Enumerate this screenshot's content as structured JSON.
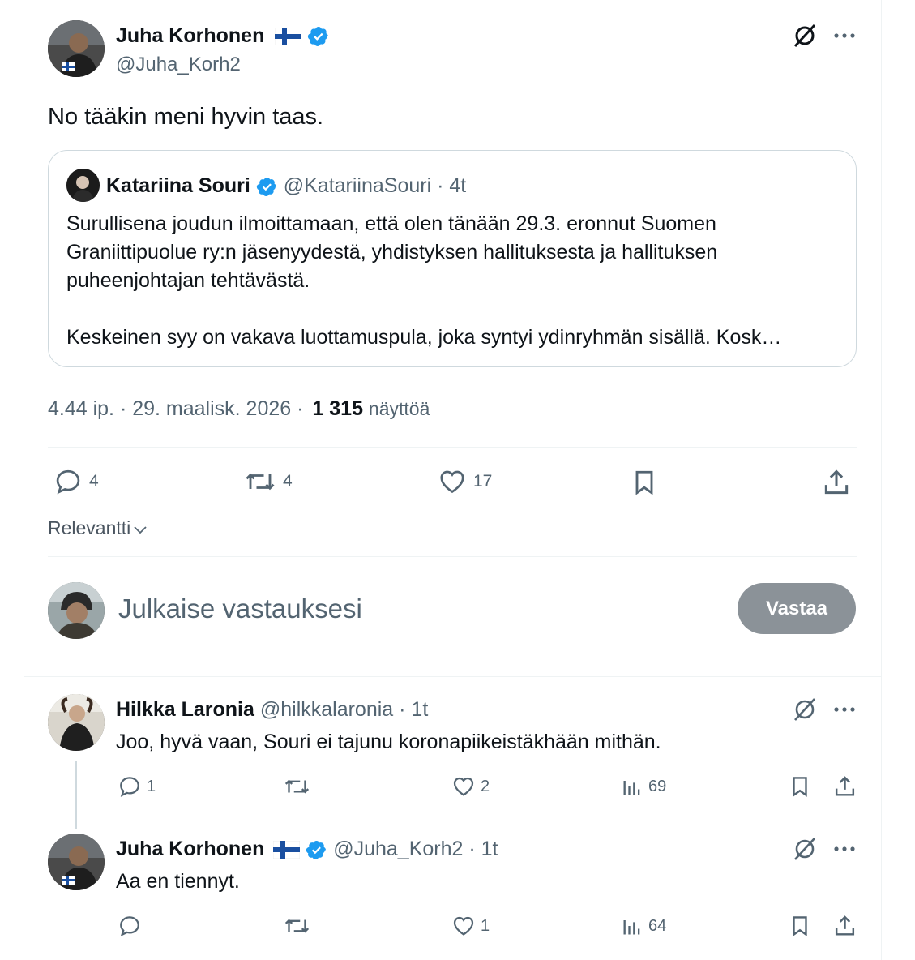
{
  "main_tweet": {
    "author_name": "Juha Korhonen",
    "author_handle": "@Juha_Korh2",
    "text": "No tääkin meni hyvin taas.",
    "timestamp": "4.44 ip. · 29. maalisk. 2026 ·",
    "views_count": "1 315",
    "views_label": "näyttöä",
    "replies": "4",
    "retweets": "4",
    "likes": "17"
  },
  "quoted_tweet": {
    "author_name": "Katariina Souri",
    "author_handle": "@KatariinaSouri",
    "time": "· 4t",
    "text_p1": "Surullisena joudun ilmoittamaan, että olen tänään 29.3. eronnut Suomen Graniittipuolue ry:n jäsenyydestä, yhdistyksen hallituksesta ja hallituksen puheenjohtajan tehtävästä.",
    "text_p2": "Keskeinen syy on vakava luottamuspula, joka syntyi ydinryhmän sisällä. Kosk…"
  },
  "sort": {
    "label": "Relevantti"
  },
  "composer": {
    "placeholder": "Julkaise vastauksesi",
    "button_label": "Vastaa"
  },
  "replies": [
    {
      "author_name": "Hilkka Laronia",
      "author_handle": "@hilkkalaronia",
      "time": "· 1t",
      "text": "Joo, hyvä vaan, Souri ei tajunu koronapiikeistäkhään mithän.",
      "replies": "1",
      "retweets": "",
      "likes": "2",
      "views": "69"
    },
    {
      "author_name": "Juha Korhonen",
      "author_handle": "@Juha_Korh2",
      "time": "· 1t",
      "text": "Aa en tiennyt.",
      "replies": "",
      "retweets": "",
      "likes": "1",
      "views": "64"
    }
  ],
  "colors": {
    "text": "#0f1419",
    "muted": "#536471",
    "verified": "#1d9bf0",
    "border": "#eff3f4",
    "reply_button": "#8b9298"
  }
}
